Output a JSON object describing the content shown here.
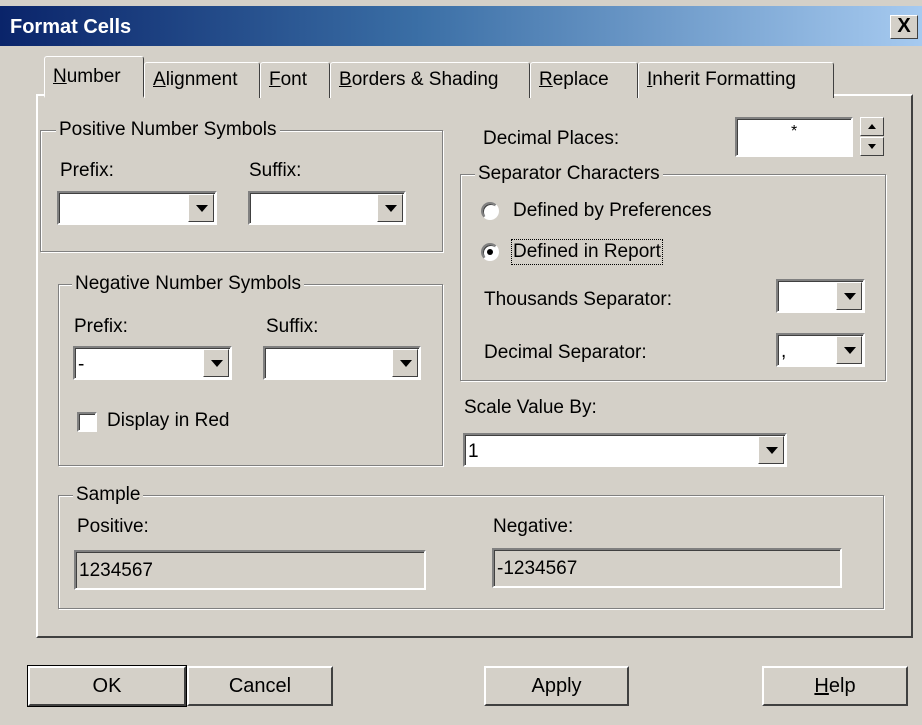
{
  "window": {
    "title": "Format Cells",
    "close_glyph": "X"
  },
  "tabs": [
    {
      "pre": "",
      "key": "N",
      "post": "umber",
      "active": true
    },
    {
      "pre": "",
      "key": "A",
      "post": "lignment"
    },
    {
      "pre": "",
      "key": "F",
      "post": "ont"
    },
    {
      "pre": "",
      "key": "B",
      "post": "orders & Shading"
    },
    {
      "pre": "",
      "key": "R",
      "post": "eplace"
    },
    {
      "pre": "",
      "key": "I",
      "post": "nherit Formatting"
    }
  ],
  "positive": {
    "title": "Positive Number Symbols",
    "prefix_label": "Prefix:",
    "suffix_label": "Suffix:",
    "prefix_value": "",
    "suffix_value": ""
  },
  "negative": {
    "title": "Negative Number Symbols",
    "prefix_label": "Prefix:",
    "suffix_label": "Suffix:",
    "prefix_value": "-",
    "suffix_value": "",
    "display_red_label": "Display in Red",
    "display_red_checked": false
  },
  "decimal_places": {
    "label": "Decimal Places:",
    "value": "*"
  },
  "separator": {
    "title": "Separator Characters",
    "options": [
      {
        "label": "Defined by Preferences",
        "selected": false
      },
      {
        "label": "Defined in Report",
        "selected": true
      }
    ],
    "thousands_label": "Thousands Separator:",
    "thousands_value": "",
    "decimal_label": "Decimal Separator:",
    "decimal_value": ","
  },
  "scale": {
    "label": "Scale Value By:",
    "value": "1"
  },
  "sample": {
    "title": "Sample",
    "positive_label": "Positive:",
    "positive_value": "1234567",
    "negative_label": "Negative:",
    "negative_value": "-1234567"
  },
  "buttons": {
    "ok": "OK",
    "cancel": "Cancel",
    "apply": "Apply",
    "help_key": "H",
    "help_rest": "elp"
  }
}
